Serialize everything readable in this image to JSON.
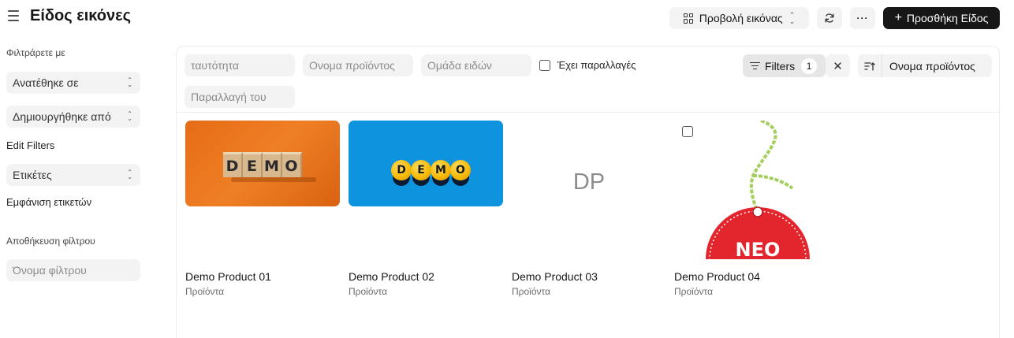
{
  "header": {
    "title": "Είδος εικόνες",
    "view_selector": "Προβολή εικόνας",
    "more_label": "···",
    "add_button": "Προσθήκη Είδος"
  },
  "sidebar": {
    "filter_by_label": "Φιλτράρετε με",
    "assigned_to": "Ανατέθηκε σε",
    "created_by": "Δημιουργήθηκε από",
    "edit_filters": "Edit Filters",
    "tags": "Ετικέτες",
    "show_tags": "Εμφάνιση ετικετών",
    "save_filter_label": "Αποθήκευση φίλτρου",
    "filter_name_placeholder": "Όνομα φίλτρου"
  },
  "filters": {
    "id_placeholder": "ταυτότητα",
    "item_name_placeholder": "Ονομα προϊόντος",
    "item_group_placeholder": "Ομάδα ειδών",
    "has_variants_label": "Έχει παραλλαγές",
    "variant_of_placeholder": "Παραλλαγή του",
    "filters_label": "Filters",
    "filters_count": "1",
    "sort_field": "Ονομα προϊόντος"
  },
  "cards": [
    {
      "title": "Demo Product 01",
      "subtitle": "Προϊόντα",
      "image_text": "DEMO"
    },
    {
      "title": "Demo Product 02",
      "subtitle": "Προϊόντα",
      "image_text": "DEMO"
    },
    {
      "title": "Demo Product 03",
      "subtitle": "Προϊόντα",
      "placeholder": "DP"
    },
    {
      "title": "Demo Product 04",
      "subtitle": "Προϊόντα",
      "image_text": "NEO"
    }
  ],
  "colors": {
    "primary_button": "#171717",
    "control_bg": "#f3f3f3",
    "tag_red": "#e3262d",
    "tag_string": "#a4cf5c"
  },
  "icons": [
    "menu-icon",
    "grid-icon",
    "updown-icon",
    "refresh-icon",
    "more-icon",
    "plus-icon",
    "filter-icon",
    "close-icon",
    "sort-icon"
  ]
}
